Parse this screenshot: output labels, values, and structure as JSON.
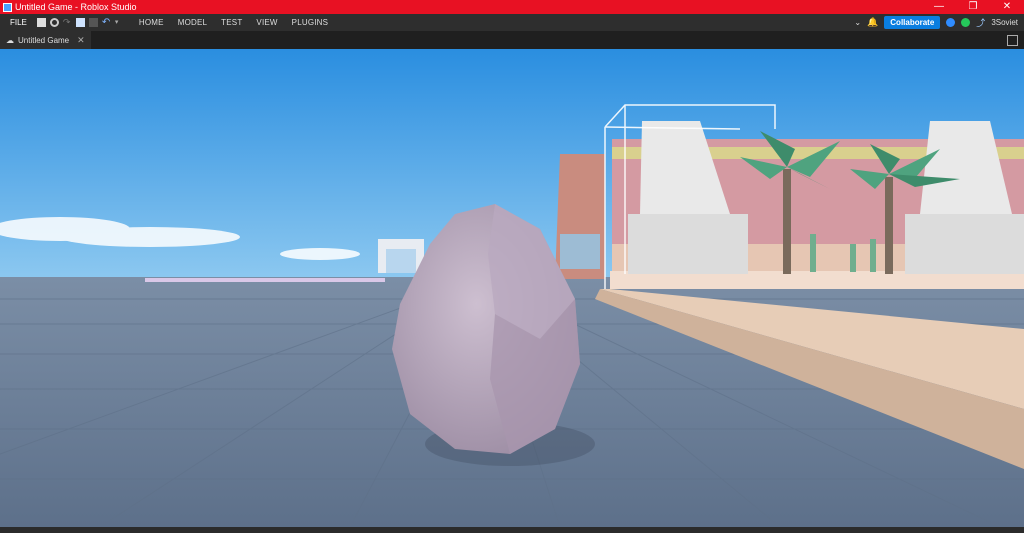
{
  "window": {
    "title": "Untitled Game - Roblox Studio",
    "controls": [
      "—",
      "❐",
      "✕"
    ]
  },
  "menubar": {
    "file_label": "FILE",
    "items": [
      "HOME",
      "MODEL",
      "TEST",
      "VIEW",
      "PLUGINS"
    ],
    "collaborate_label": "Collaborate",
    "username": "3Soviet"
  },
  "tab": {
    "label": "Untitled Game",
    "close": "✕"
  },
  "colors": {
    "titlebar": "#e81123",
    "accent": "#0a7ee0",
    "sky_top": "#2a8ee0",
    "ground": "#6f8199"
  }
}
